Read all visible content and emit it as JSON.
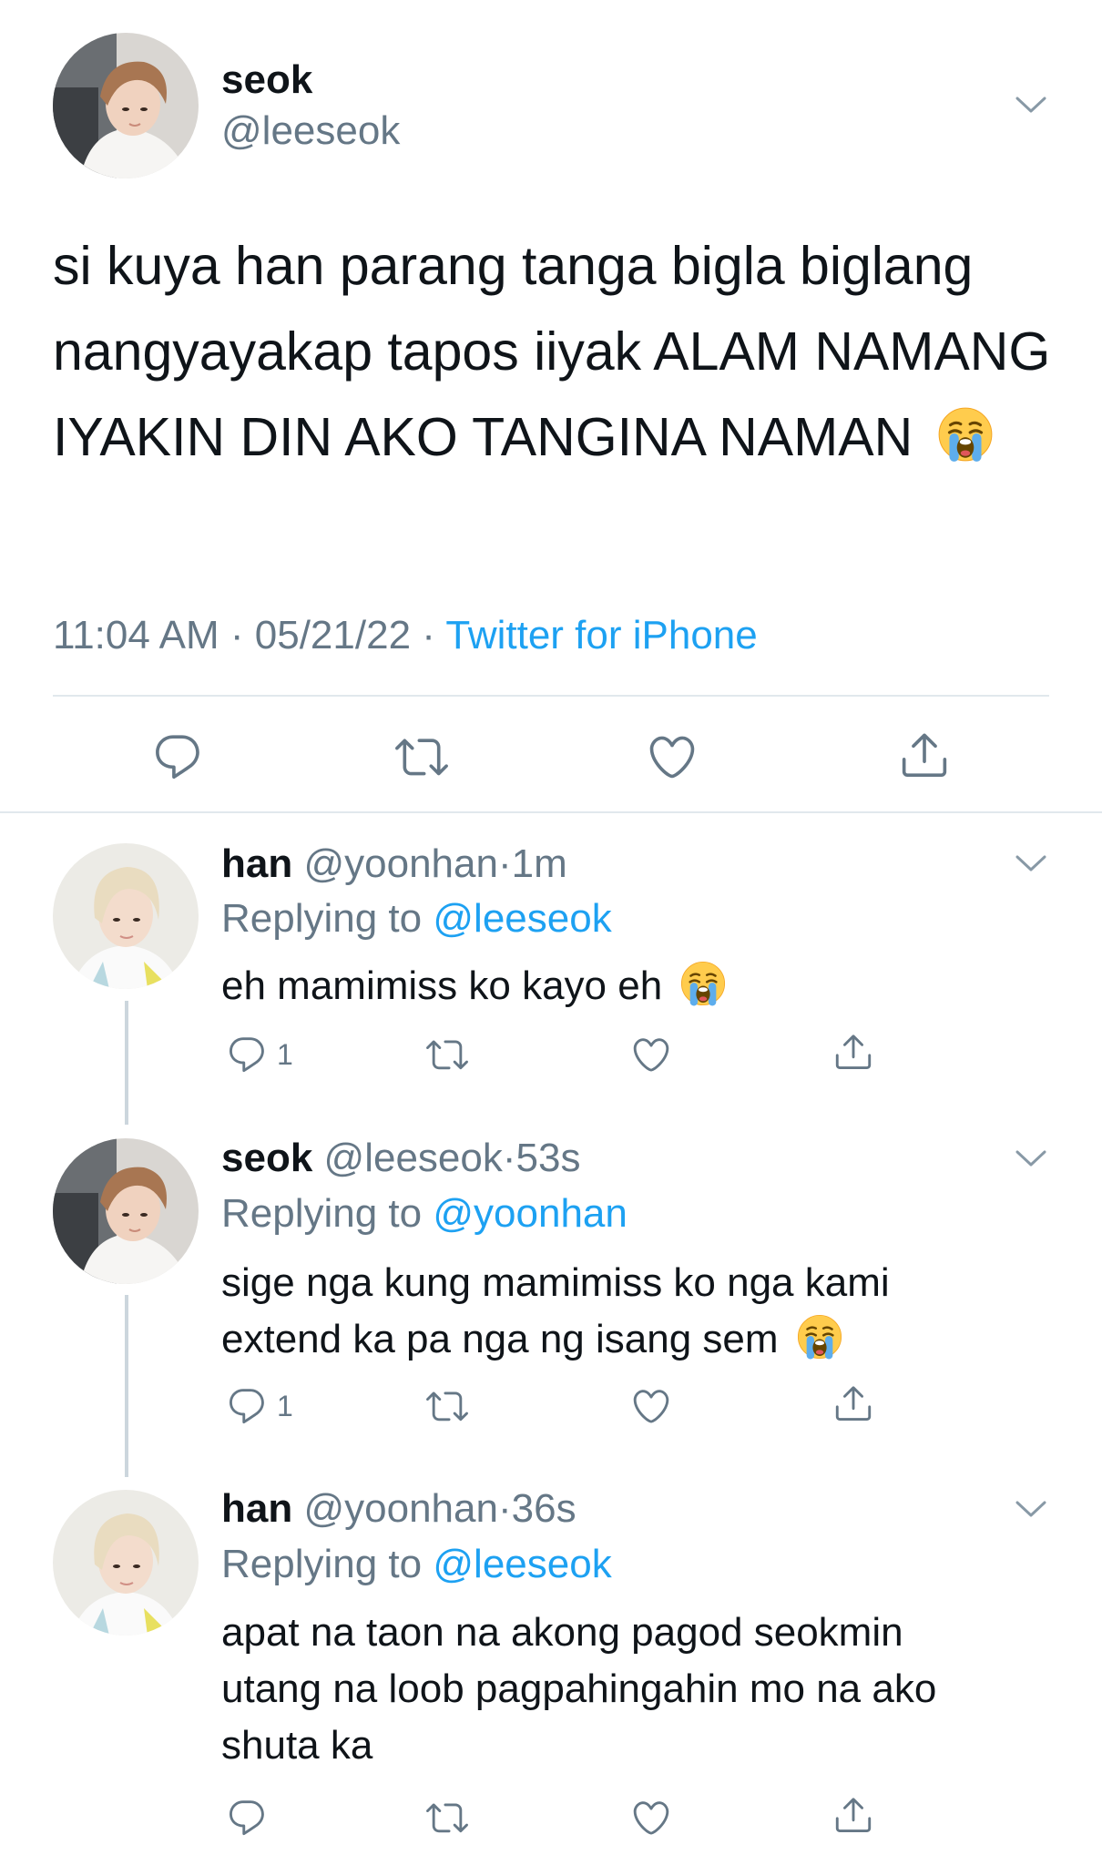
{
  "main_tweet": {
    "display_name": "seok",
    "handle": "@leeseok",
    "text": "si kuya han parang tanga bigla biglang nangyayakap tapos iiyak ALAM NAMANG IYAKIN DIN AKO TANGINA NAMAN",
    "emoji": "loudly-crying-face",
    "time": "11:04 AM",
    "date": "05/21/22",
    "separator": "·",
    "source": "Twitter for iPhone",
    "actions": [
      "reply-icon",
      "retweet-icon",
      "like-icon",
      "share-icon"
    ]
  },
  "replies": [
    {
      "display_name": "han",
      "handle": "@yoonhan",
      "separator": "·",
      "age": "1m",
      "replying_prefix": "Replying to",
      "replying_to": "@leeseok",
      "text": "eh mamimiss ko kayo eh",
      "emoji": "loudly-crying-face",
      "reply_count": "1"
    },
    {
      "display_name": "seok",
      "handle": "@leeseok",
      "separator": "·",
      "age": "53s",
      "replying_prefix": "Replying to",
      "replying_to": "@yoonhan",
      "text_line1": "sige nga kung mamimiss ko nga kami",
      "text_line2": "extend ka pa nga ng isang sem",
      "emoji": "loudly-crying-face",
      "reply_count": "1"
    },
    {
      "display_name": "han",
      "handle": "@yoonhan",
      "separator": "·",
      "age": "36s",
      "replying_prefix": "Replying to",
      "replying_to": "@leeseok",
      "text_line1": "apat na taon na akong pagod seokmin",
      "text_line2": "utang na loob pagpahingahin mo na ako",
      "text_line3": "shuta ka",
      "reply_count": ""
    }
  ],
  "colors": {
    "link": "#1da1f2",
    "secondary": "#657786",
    "text": "#0f1419",
    "divider": "#e1e8ed"
  }
}
